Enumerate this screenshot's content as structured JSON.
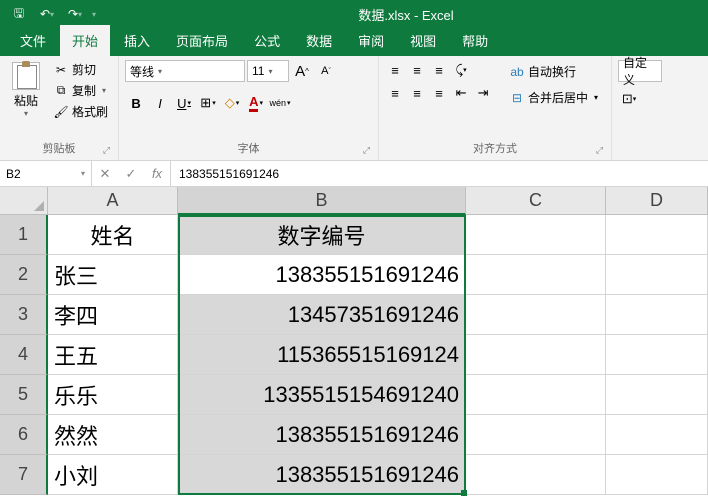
{
  "app": {
    "title": "数据.xlsx - Excel"
  },
  "qat": {
    "save": "💾",
    "undo": "↶",
    "redo": "↷"
  },
  "tabs": {
    "file": "文件",
    "home": "开始",
    "insert": "插入",
    "layout": "页面布局",
    "formulas": "公式",
    "data": "数据",
    "review": "审阅",
    "view": "视图",
    "help": "帮助"
  },
  "ribbon": {
    "clipboard": {
      "paste": "粘贴",
      "cut": "剪切",
      "copy": "复制",
      "format": "格式刷",
      "label": "剪贴板"
    },
    "font": {
      "name": "等线",
      "size": "11",
      "grow": "A",
      "shrink": "A",
      "bold": "B",
      "italic": "I",
      "underline": "U",
      "wen": "wén",
      "label": "字体"
    },
    "align": {
      "wrap": "自动换行",
      "merge": "合并后居中",
      "label": "对齐方式"
    },
    "custom": "自定义"
  },
  "namebox": "B2",
  "formula": "138355151691246",
  "cols": [
    "A",
    "B",
    "C",
    "D"
  ],
  "rows": [
    "1",
    "2",
    "3",
    "4",
    "5",
    "6",
    "7"
  ],
  "hdr": {
    "a": "姓名",
    "b": "数字编号"
  },
  "data": [
    {
      "a": "张三",
      "b": "138355151691246"
    },
    {
      "a": "李四",
      "b": "13457351691246"
    },
    {
      "a": "王五",
      "b": "115365515169124"
    },
    {
      "a": "乐乐",
      "b": "1335515154691240"
    },
    {
      "a": "然然",
      "b": "138355151691246"
    },
    {
      "a": "小刘",
      "b": "138355151691246"
    }
  ]
}
